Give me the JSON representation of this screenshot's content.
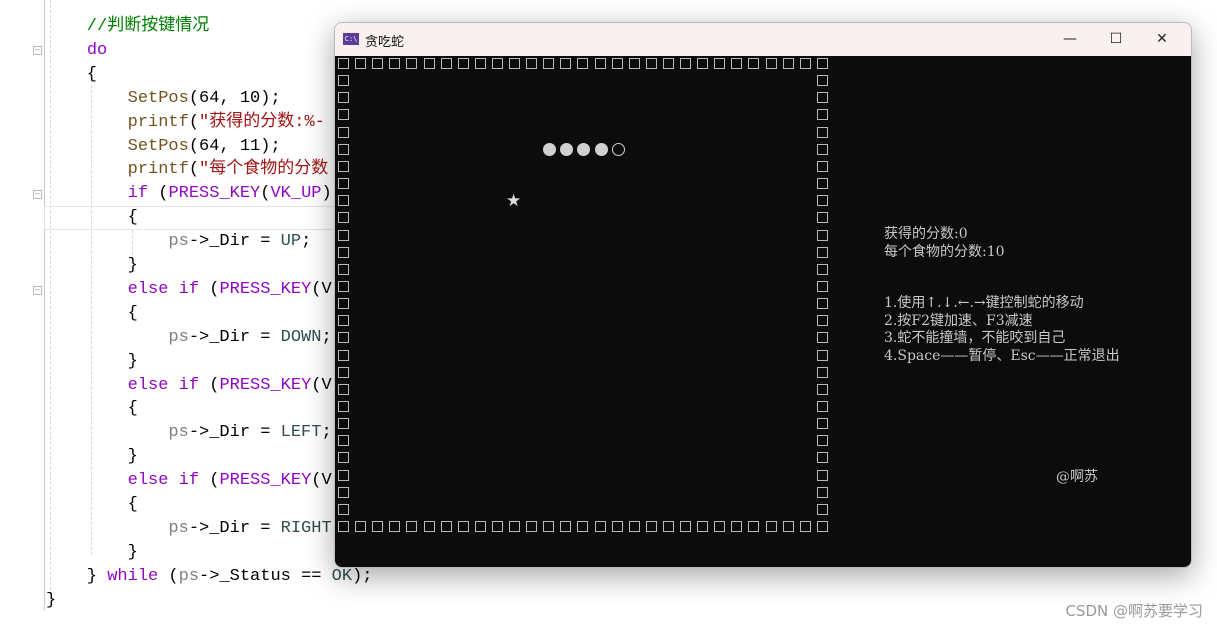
{
  "editor": {
    "lines": [
      [
        [
          "    //判断按键情况",
          "t-cm"
        ]
      ],
      [
        [
          "    ",
          "t-pl"
        ],
        [
          "do",
          "t-kw"
        ]
      ],
      [
        [
          "    {",
          "t-pl"
        ]
      ],
      [
        [
          "        ",
          "t-pl"
        ],
        [
          "SetPos",
          "t-fn"
        ],
        [
          "(64, 10);",
          "t-pl"
        ]
      ],
      [
        [
          "        ",
          "t-pl"
        ],
        [
          "printf",
          "t-fn"
        ],
        [
          "(",
          "t-pl"
        ],
        [
          "\"获得的分数:%-",
          "t-st"
        ]
      ],
      [
        [
          "        ",
          "t-pl"
        ],
        [
          "SetPos",
          "t-fn"
        ],
        [
          "(64, 11);",
          "t-pl"
        ]
      ],
      [
        [
          "        ",
          "t-pl"
        ],
        [
          "printf",
          "t-fn"
        ],
        [
          "(",
          "t-pl"
        ],
        [
          "\"每个食物的分数",
          "t-st"
        ]
      ],
      [
        [
          "        ",
          "t-pl"
        ],
        [
          "if",
          "t-kw"
        ],
        [
          " (",
          "t-pl"
        ],
        [
          "PRESS_KEY",
          "t-mc"
        ],
        [
          "(",
          "t-pl"
        ],
        [
          "VK_UP",
          "t-mc"
        ],
        [
          ")",
          "t-pl"
        ]
      ],
      [
        [
          "        {",
          "t-pl"
        ]
      ],
      [
        [
          "            ",
          "t-pl"
        ],
        [
          "ps",
          "t-id"
        ],
        [
          "->_Dir = ",
          "t-pl"
        ],
        [
          "UP",
          "t-en"
        ],
        [
          ";",
          "t-pl"
        ]
      ],
      [
        [
          "        }",
          "t-pl"
        ]
      ],
      [
        [
          "        ",
          "t-pl"
        ],
        [
          "else if",
          "t-kw"
        ],
        [
          " (",
          "t-pl"
        ],
        [
          "PRESS_KEY",
          "t-mc"
        ],
        [
          "(V",
          "t-pl"
        ]
      ],
      [
        [
          "        {",
          "t-pl"
        ]
      ],
      [
        [
          "            ",
          "t-pl"
        ],
        [
          "ps",
          "t-id"
        ],
        [
          "->_Dir = ",
          "t-pl"
        ],
        [
          "DOWN",
          "t-en"
        ],
        [
          ";",
          "t-pl"
        ]
      ],
      [
        [
          "        }",
          "t-pl"
        ]
      ],
      [
        [
          "        ",
          "t-pl"
        ],
        [
          "else if",
          "t-kw"
        ],
        [
          " (",
          "t-pl"
        ],
        [
          "PRESS_KEY",
          "t-mc"
        ],
        [
          "(V",
          "t-pl"
        ]
      ],
      [
        [
          "        {",
          "t-pl"
        ]
      ],
      [
        [
          "            ",
          "t-pl"
        ],
        [
          "ps",
          "t-id"
        ],
        [
          "->_Dir = ",
          "t-pl"
        ],
        [
          "LEFT",
          "t-en"
        ],
        [
          ";",
          "t-pl"
        ]
      ],
      [
        [
          "        }",
          "t-pl"
        ]
      ],
      [
        [
          "        ",
          "t-pl"
        ],
        [
          "else if",
          "t-kw"
        ],
        [
          " (",
          "t-pl"
        ],
        [
          "PRESS_KEY",
          "t-mc"
        ],
        [
          "(V",
          "t-pl"
        ]
      ],
      [
        [
          "        {",
          "t-pl"
        ]
      ],
      [
        [
          "            ",
          "t-pl"
        ],
        [
          "ps",
          "t-id"
        ],
        [
          "->_Dir = ",
          "t-pl"
        ],
        [
          "RIGHT",
          "t-en"
        ]
      ],
      [
        [
          "        }",
          "t-pl"
        ]
      ],
      [
        [
          "    } ",
          "t-pl"
        ],
        [
          "while",
          "t-kw"
        ],
        [
          " (",
          "t-pl"
        ],
        [
          "ps",
          "t-id"
        ],
        [
          "->_Status == ",
          "t-pl"
        ],
        [
          "OK",
          "t-en"
        ],
        [
          ");",
          "t-pl"
        ]
      ],
      [
        [
          "}",
          "t-pl"
        ]
      ]
    ]
  },
  "window": {
    "title": "贪吃蛇",
    "icon": "console-icon",
    "minimize": "—",
    "maximize": "☐",
    "close": "✕"
  },
  "game": {
    "wall_glyph": "□",
    "snake_body_count": 4,
    "food": "★",
    "score_line": "获得的分数:0",
    "food_score_line": "每个食物的分数:10",
    "help": [
      "1.使用↑.↓.←.→键控制蛇的移动",
      "2.按F2键加速、F3减速",
      "3.蛇不能撞墙，不能咬到自己",
      "4.Space——暂停、Esc——正常退出"
    ],
    "author": "@啊苏"
  },
  "watermark": "CSDN @啊苏要学习"
}
